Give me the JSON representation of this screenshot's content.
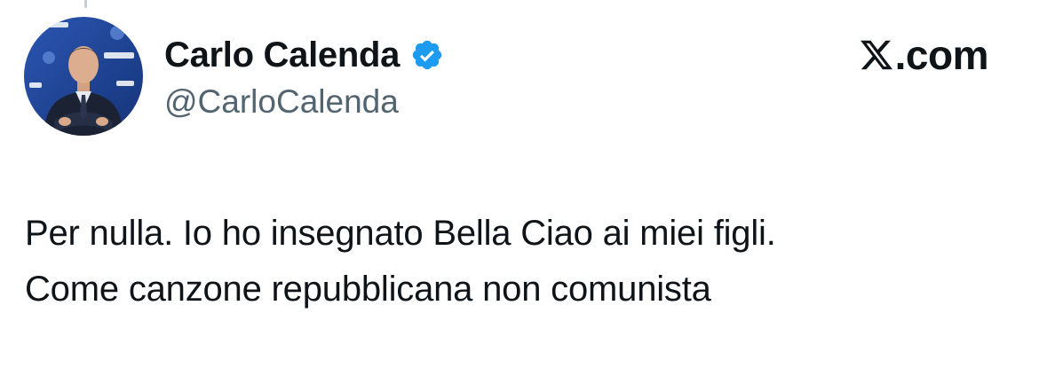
{
  "author": {
    "display_name": "Carlo Calenda",
    "handle": "@CarloCalenda",
    "verified": true,
    "verified_color": "#1d9bf0"
  },
  "brand": {
    "text": ".com",
    "logo_icon": "x-logo-icon"
  },
  "tweet": {
    "lines": [
      "Per nulla. Io ho insegnato Bella Ciao ai miei figli.",
      "Come canzone repubblicana non comunista"
    ]
  },
  "avatar": {
    "icon": "profile-photo",
    "backdrop_color": "#1c3f8c"
  },
  "colors": {
    "text": "#0f1419",
    "secondary_text": "#536471",
    "background": "#ffffff"
  }
}
